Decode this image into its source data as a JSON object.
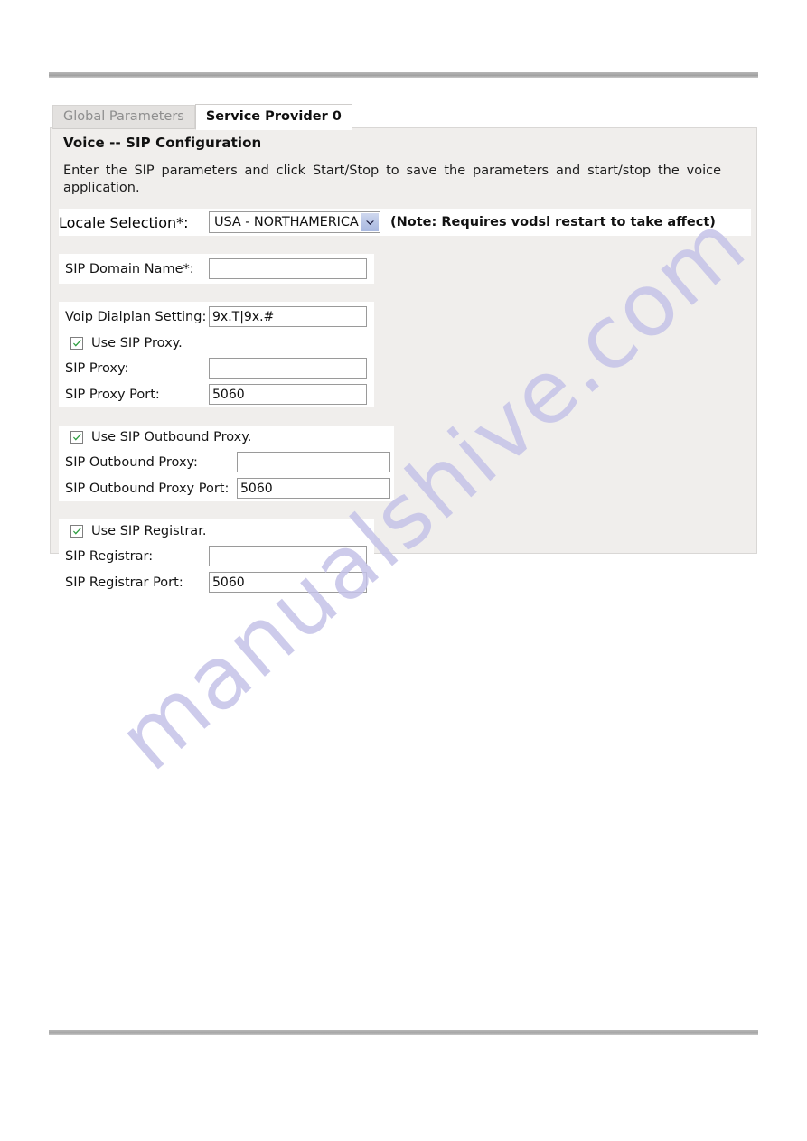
{
  "tabs": [
    {
      "id": "global-parameters",
      "label": "Global Parameters",
      "active": false
    },
    {
      "id": "service-provider-0",
      "label": "Service Provider 0",
      "active": true
    }
  ],
  "panel": {
    "title": "Voice -- SIP Configuration",
    "description": "Enter the SIP parameters and click Start/Stop to save the parameters and start/stop the voice application."
  },
  "form": {
    "locale": {
      "label": "Locale Selection*:",
      "value": "USA - NORTHAMERICA",
      "note": "(Note: Requires vodsl restart to take affect)"
    },
    "sip_domain_name": {
      "label": "SIP Domain Name*:",
      "value": "",
      "placeholder": ""
    },
    "voip_dialplan": {
      "label": "Voip Dialplan Setting:",
      "value": "9x.T|9x.#",
      "placeholder": ""
    },
    "use_sip_proxy": {
      "label": "Use SIP Proxy.",
      "checked": true
    },
    "sip_proxy": {
      "label": "SIP Proxy:",
      "value": "",
      "placeholder": ""
    },
    "sip_proxy_port": {
      "label": "SIP Proxy Port:",
      "value": "5060",
      "placeholder": ""
    },
    "use_sip_outbound_proxy": {
      "label": "Use SIP Outbound Proxy.",
      "checked": true
    },
    "sip_outbound_proxy": {
      "label": "SIP Outbound Proxy:",
      "value": "",
      "placeholder": ""
    },
    "sip_outbound_proxy_port": {
      "label": "SIP Outbound Proxy Port:",
      "value": "5060",
      "placeholder": ""
    },
    "use_sip_registrar": {
      "label": "Use SIP Registrar.",
      "checked": true
    },
    "sip_registrar": {
      "label": "SIP Registrar:",
      "value": "",
      "placeholder": ""
    },
    "sip_registrar_port": {
      "label": "SIP Registrar Port:",
      "value": "5060",
      "placeholder": ""
    }
  },
  "watermark": {
    "text": "manualshive.com"
  },
  "colors": {
    "panel_bg": "#f0eeec",
    "field_bg": "#ffffff",
    "tab_inactive_bg": "#e3e1df",
    "tab_inactive_text": "#8e8e8e",
    "checkmark": "#2e9e41",
    "select_arrow": "#b9c6e6",
    "watermark": "#c5c3e8",
    "rule": "#a7a7a7"
  }
}
